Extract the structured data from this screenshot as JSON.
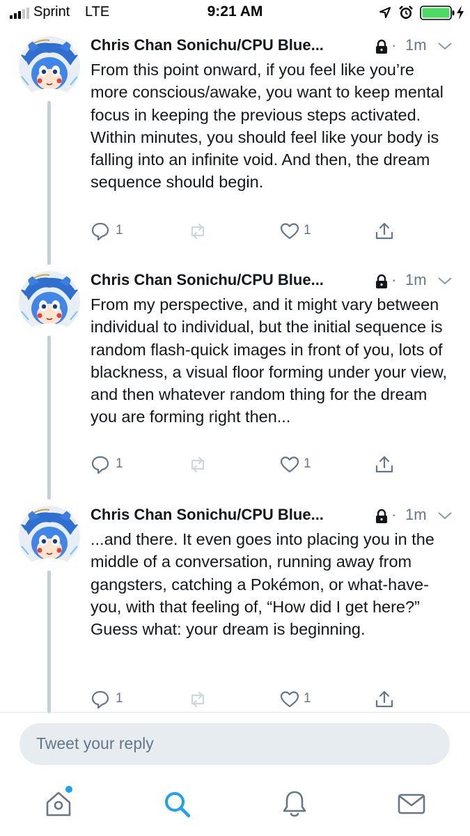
{
  "status_bar": {
    "carrier": "Sprint",
    "network": "LTE",
    "time": "9:21 AM",
    "signal_bars_filled": 3,
    "signal_bars_total": 5,
    "battery_level": 1.0,
    "charging": true,
    "icons": [
      "signal-icon",
      "location-arrow-icon",
      "alarm-clock-icon",
      "battery-icon",
      "charging-bolt-icon"
    ]
  },
  "tweets": [
    {
      "author": "Chris Chan Sonichu/CPU Blue...",
      "protected": true,
      "dot": "·",
      "time": "1m",
      "text": "From this point onward, if you feel like you’re more conscious/awake, you want to keep mental focus in keeping the previous steps activated. Within minutes, you should feel like your body is falling into an infinite void. And then, the dream sequence should begin.",
      "reply_count": "1",
      "like_count": "1"
    },
    {
      "author": "Chris Chan Sonichu/CPU Blue...",
      "protected": true,
      "dot": "·",
      "time": "1m",
      "text": "From my perspective, and it might vary between individual to individual, but the initial sequence is random flash-quick images in front of you, lots of blackness, a visual floor forming under your view, and then whatever random thing for the dream you are forming right then...",
      "reply_count": "1",
      "like_count": "1"
    },
    {
      "author": "Chris Chan Sonichu/CPU Blue...",
      "protected": true,
      "dot": "·",
      "time": "1m",
      "text": "...and there. It even goes into placing you in the middle of a conversation, running away from gangsters, catching a Pokémon, or what-have-you, with that feeling of, “How did I get here?” Guess what: your dream is beginning.",
      "reply_count": "1",
      "like_count": "1"
    }
  ],
  "reply_bar": {
    "placeholder": "Tweet your reply"
  },
  "tab_bar": {
    "tabs": [
      "home-icon",
      "search-icon",
      "notifications-bell-icon",
      "messages-envelope-icon"
    ],
    "active": "search-icon",
    "home_has_badge": true
  },
  "colors": {
    "accent": "#1da1f2",
    "text_primary": "#14171a",
    "text_secondary": "#657786",
    "thread_line": "#c4cfd6",
    "reply_box": "#e6ecf0",
    "battery_green": "#4cd964"
  }
}
